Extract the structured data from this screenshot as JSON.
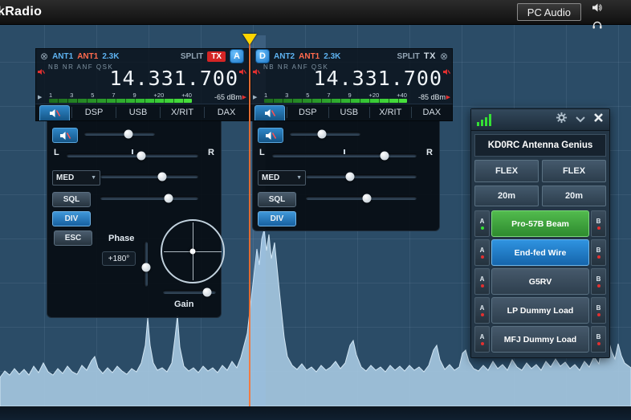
{
  "titlebar": {
    "app_name": "kRadio",
    "pc_audio": "PC Audio"
  },
  "icons": {
    "close_slice": "⊗",
    "marker_left": "▶",
    "marker_right": "▶",
    "agc_dropdown_arrow": "▼"
  },
  "slice_a": {
    "rx_ant": "ANT1",
    "tx_ant": "ANT1",
    "filter": "2.3K",
    "flags": "NB NR ANF QSK",
    "split": "SPLIT",
    "tx": "TX",
    "badge": "A",
    "frequency": "14.331.700",
    "meter_scale": [
      "1",
      "3",
      "5",
      "7",
      "9",
      "+20",
      "+40"
    ],
    "level": "-65 dBm",
    "tabs": {
      "dsp": "DSP",
      "usb": "USB",
      "xrit": "X/RIT",
      "dax": "DAX"
    },
    "pan_left": "L",
    "pan_right": "R",
    "agc": "MED",
    "sql": "SQL",
    "div": "DIV",
    "esc": "ESC",
    "phase_label": "Phase",
    "phase_value": "+180°",
    "gain_label": "Gain"
  },
  "slice_d": {
    "rx_ant": "ANT2",
    "tx_ant": "ANT1",
    "filter": "2.3K",
    "flags": "NB NR ANF QSK",
    "split": "SPLIT",
    "tx": "TX",
    "badge": "D",
    "frequency": "14.331.700",
    "meter_scale": [
      "1",
      "3",
      "5",
      "7",
      "9",
      "+20",
      "+40"
    ],
    "level": "-85 dBm",
    "tabs": {
      "dsp": "DSP",
      "usb": "USB",
      "xrit": "X/RIT",
      "dax": "DAX"
    },
    "pan_left": "L",
    "pan_right": "R",
    "agc": "MED",
    "sql": "SQL",
    "div": "DIV"
  },
  "antenna_genius": {
    "title": "KD0RC Antenna Genius",
    "radio_a": "FLEX",
    "radio_b": "FLEX",
    "band_a": "20m",
    "band_b": "20m",
    "port_a": "A",
    "port_b": "B",
    "antennas": [
      {
        "name": "Pro-57B Beam"
      },
      {
        "name": "End-fed Wire"
      },
      {
        "name": "G5RV"
      },
      {
        "name": "LP Dummy Load"
      },
      {
        "name": "MFJ Dummy Load"
      }
    ]
  }
}
